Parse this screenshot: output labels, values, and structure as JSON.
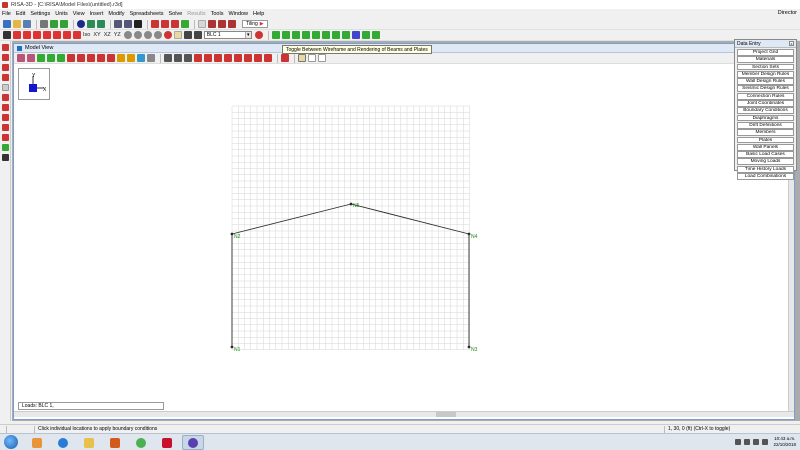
{
  "window": {
    "title": "RISA-3D - [C:\\RISA\\Model Files\\(untitled).r3d]"
  },
  "menu": {
    "items": [
      "File",
      "Edit",
      "Settings",
      "Units",
      "View",
      "Insert",
      "Modify",
      "Spreadsheets",
      "Solve",
      "Results",
      "Tools",
      "Window",
      "Help"
    ],
    "disabled_item": "Results",
    "director_label": "Director"
  },
  "toolbar": {
    "tiling_label": "Tiling",
    "view_buttons": [
      "Iso",
      "XY",
      "XZ",
      "YZ"
    ],
    "load_combo_value": "BLC 1"
  },
  "model_view": {
    "title": "Model View",
    "tooltip": "Toggle Between Wireframe and Rendering of Beams and Plates",
    "axis_y": "Y",
    "axis_x": "X",
    "loads_label": "Loads: BLC 1,",
    "nodes": [
      {
        "label": "N1"
      },
      {
        "label": "N2"
      },
      {
        "label": "N3"
      },
      {
        "label": "N4"
      },
      {
        "label": "N5"
      }
    ]
  },
  "data_entry": {
    "title": "Data Entry",
    "close_icon": "x",
    "items": [
      "Project Grid",
      "Materials",
      "Section Sets",
      "Member Design Rules",
      "Wall Design Rules",
      "Seismic Design Rules",
      "Connection Rules",
      "Joint Coordinates",
      "Boundary Conditions",
      "Diaphragms",
      "Drift Definitions",
      "Members",
      "Plates",
      "Wall Panels",
      "Basic Load Cases",
      "Moving Loads",
      "Time History Loads",
      "Load Combinations"
    ]
  },
  "status": {
    "message": "Click individual locations to apply boundary conditions",
    "coords": "1, 30, 0 (ft)   (Ctrl-X to toggle)"
  },
  "taskbar": {
    "time": "10:43 a.m.",
    "date": "22/10/2018"
  },
  "colors": {
    "grid": "#d6d6d6",
    "member": "#2b2b2b",
    "node_label": "#1d8a1d",
    "axis_cube": "#1515d0"
  }
}
